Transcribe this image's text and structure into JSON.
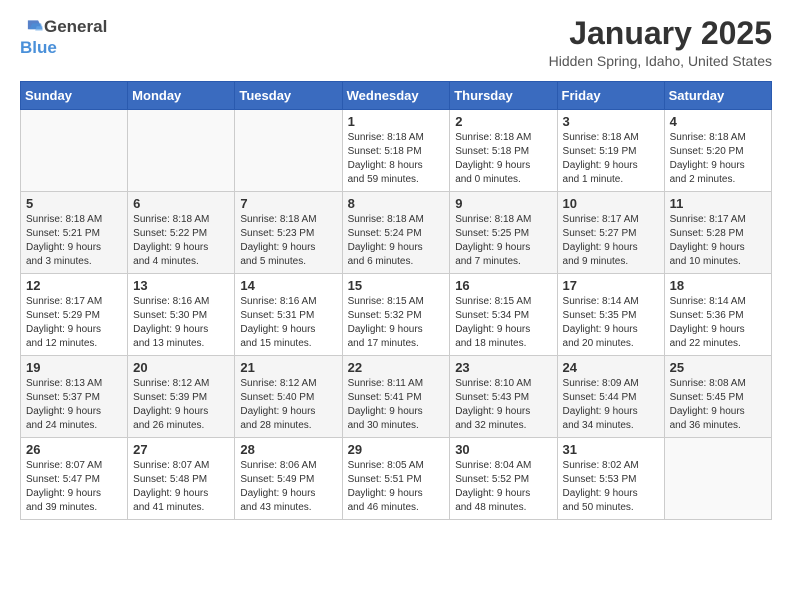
{
  "header": {
    "logo_general": "General",
    "logo_blue": "Blue",
    "title": "January 2025",
    "subtitle": "Hidden Spring, Idaho, United States"
  },
  "weekdays": [
    "Sunday",
    "Monday",
    "Tuesday",
    "Wednesday",
    "Thursday",
    "Friday",
    "Saturday"
  ],
  "weeks": [
    [
      {
        "day": "",
        "info": ""
      },
      {
        "day": "",
        "info": ""
      },
      {
        "day": "",
        "info": ""
      },
      {
        "day": "1",
        "info": "Sunrise: 8:18 AM\nSunset: 5:18 PM\nDaylight: 8 hours\nand 59 minutes."
      },
      {
        "day": "2",
        "info": "Sunrise: 8:18 AM\nSunset: 5:18 PM\nDaylight: 9 hours\nand 0 minutes."
      },
      {
        "day": "3",
        "info": "Sunrise: 8:18 AM\nSunset: 5:19 PM\nDaylight: 9 hours\nand 1 minute."
      },
      {
        "day": "4",
        "info": "Sunrise: 8:18 AM\nSunset: 5:20 PM\nDaylight: 9 hours\nand 2 minutes."
      }
    ],
    [
      {
        "day": "5",
        "info": "Sunrise: 8:18 AM\nSunset: 5:21 PM\nDaylight: 9 hours\nand 3 minutes."
      },
      {
        "day": "6",
        "info": "Sunrise: 8:18 AM\nSunset: 5:22 PM\nDaylight: 9 hours\nand 4 minutes."
      },
      {
        "day": "7",
        "info": "Sunrise: 8:18 AM\nSunset: 5:23 PM\nDaylight: 9 hours\nand 5 minutes."
      },
      {
        "day": "8",
        "info": "Sunrise: 8:18 AM\nSunset: 5:24 PM\nDaylight: 9 hours\nand 6 minutes."
      },
      {
        "day": "9",
        "info": "Sunrise: 8:18 AM\nSunset: 5:25 PM\nDaylight: 9 hours\nand 7 minutes."
      },
      {
        "day": "10",
        "info": "Sunrise: 8:17 AM\nSunset: 5:27 PM\nDaylight: 9 hours\nand 9 minutes."
      },
      {
        "day": "11",
        "info": "Sunrise: 8:17 AM\nSunset: 5:28 PM\nDaylight: 9 hours\nand 10 minutes."
      }
    ],
    [
      {
        "day": "12",
        "info": "Sunrise: 8:17 AM\nSunset: 5:29 PM\nDaylight: 9 hours\nand 12 minutes."
      },
      {
        "day": "13",
        "info": "Sunrise: 8:16 AM\nSunset: 5:30 PM\nDaylight: 9 hours\nand 13 minutes."
      },
      {
        "day": "14",
        "info": "Sunrise: 8:16 AM\nSunset: 5:31 PM\nDaylight: 9 hours\nand 15 minutes."
      },
      {
        "day": "15",
        "info": "Sunrise: 8:15 AM\nSunset: 5:32 PM\nDaylight: 9 hours\nand 17 minutes."
      },
      {
        "day": "16",
        "info": "Sunrise: 8:15 AM\nSunset: 5:34 PM\nDaylight: 9 hours\nand 18 minutes."
      },
      {
        "day": "17",
        "info": "Sunrise: 8:14 AM\nSunset: 5:35 PM\nDaylight: 9 hours\nand 20 minutes."
      },
      {
        "day": "18",
        "info": "Sunrise: 8:14 AM\nSunset: 5:36 PM\nDaylight: 9 hours\nand 22 minutes."
      }
    ],
    [
      {
        "day": "19",
        "info": "Sunrise: 8:13 AM\nSunset: 5:37 PM\nDaylight: 9 hours\nand 24 minutes."
      },
      {
        "day": "20",
        "info": "Sunrise: 8:12 AM\nSunset: 5:39 PM\nDaylight: 9 hours\nand 26 minutes."
      },
      {
        "day": "21",
        "info": "Sunrise: 8:12 AM\nSunset: 5:40 PM\nDaylight: 9 hours\nand 28 minutes."
      },
      {
        "day": "22",
        "info": "Sunrise: 8:11 AM\nSunset: 5:41 PM\nDaylight: 9 hours\nand 30 minutes."
      },
      {
        "day": "23",
        "info": "Sunrise: 8:10 AM\nSunset: 5:43 PM\nDaylight: 9 hours\nand 32 minutes."
      },
      {
        "day": "24",
        "info": "Sunrise: 8:09 AM\nSunset: 5:44 PM\nDaylight: 9 hours\nand 34 minutes."
      },
      {
        "day": "25",
        "info": "Sunrise: 8:08 AM\nSunset: 5:45 PM\nDaylight: 9 hours\nand 36 minutes."
      }
    ],
    [
      {
        "day": "26",
        "info": "Sunrise: 8:07 AM\nSunset: 5:47 PM\nDaylight: 9 hours\nand 39 minutes."
      },
      {
        "day": "27",
        "info": "Sunrise: 8:07 AM\nSunset: 5:48 PM\nDaylight: 9 hours\nand 41 minutes."
      },
      {
        "day": "28",
        "info": "Sunrise: 8:06 AM\nSunset: 5:49 PM\nDaylight: 9 hours\nand 43 minutes."
      },
      {
        "day": "29",
        "info": "Sunrise: 8:05 AM\nSunset: 5:51 PM\nDaylight: 9 hours\nand 46 minutes."
      },
      {
        "day": "30",
        "info": "Sunrise: 8:04 AM\nSunset: 5:52 PM\nDaylight: 9 hours\nand 48 minutes."
      },
      {
        "day": "31",
        "info": "Sunrise: 8:02 AM\nSunset: 5:53 PM\nDaylight: 9 hours\nand 50 minutes."
      },
      {
        "day": "",
        "info": ""
      }
    ]
  ]
}
